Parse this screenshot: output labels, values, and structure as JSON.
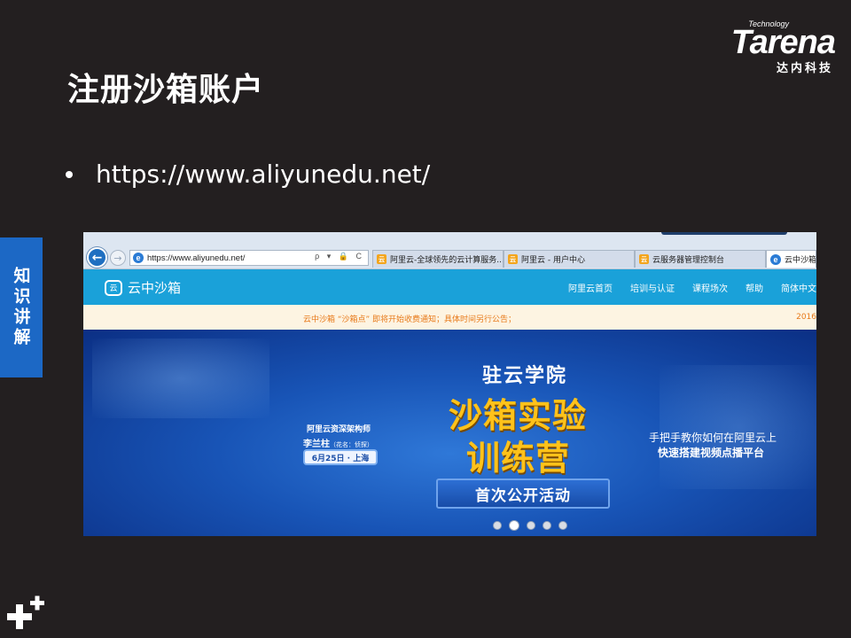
{
  "slide": {
    "title": "注册沙箱账户",
    "bullet": "https://www.aliyunedu.net/",
    "side_tab": "知识讲解",
    "logo_tech": "Technology",
    "logo_word": "Tarena",
    "logo_cn": "达内科技"
  },
  "browser": {
    "address": "https://www.aliyunedu.net/",
    "address_tools": "ρ ▾ 🔒 C",
    "tabs": [
      {
        "label": "阿里云-全球领先的云计算服务..."
      },
      {
        "label": "阿里云 - 用户中心"
      },
      {
        "label": "云服务器管理控制台"
      },
      {
        "label": "云中沙箱"
      }
    ]
  },
  "site": {
    "brand": "云中沙箱",
    "menu": [
      "阿里云首页",
      "培训与认证",
      "课程场次",
      "帮助",
      "简体中文"
    ],
    "notice": "云中沙箱 “沙箱点” 即将开始收费通知；具体时间另行公告；",
    "notice_date": "2016",
    "banner": {
      "host_role": "阿里云资深架构师",
      "host_name": "李兰柱",
      "host_alias": "（花名：侦探）",
      "date": "6月25日 · 上海",
      "title": "驻云学院",
      "line1": "沙箱实验",
      "line2": "训练营",
      "ribbon": "首次公开活动",
      "right1": "手把手教你如何在阿里云上",
      "right2": "快速搭建视频点播平台",
      "slide_count": 5,
      "active_slide": 2
    }
  }
}
